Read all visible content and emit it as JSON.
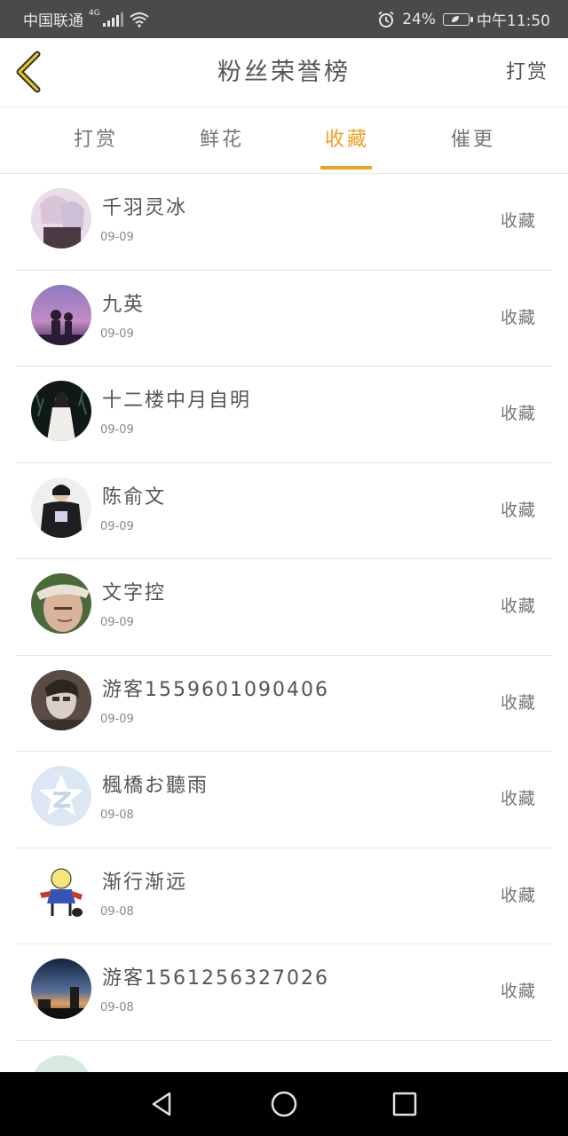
{
  "status_bar": {
    "carrier": "中国联通",
    "network": "4G",
    "battery": "24%",
    "time": "中午11:50"
  },
  "header": {
    "title": "粉丝荣誉榜",
    "action": "打赏"
  },
  "tabs": [
    {
      "label": "打赏",
      "active": false
    },
    {
      "label": "鲜花",
      "active": false
    },
    {
      "label": "收藏",
      "active": true
    },
    {
      "label": "催更",
      "active": false
    }
  ],
  "colors": {
    "accent": "#f0a020",
    "status_bar_bg": "#4a4a4a",
    "nav_bar_bg": "#000000"
  },
  "list": [
    {
      "name": "千羽灵冰",
      "date": "09-09",
      "action": "收藏",
      "avatar": "anime-girl"
    },
    {
      "name": "九英",
      "date": "09-09",
      "action": "收藏",
      "avatar": "purple-sky"
    },
    {
      "name": "十二楼中月自明",
      "date": "09-09",
      "action": "收藏",
      "avatar": "white-dress"
    },
    {
      "name": "陈俞文",
      "date": "09-09",
      "action": "收藏",
      "avatar": "dark-hoodie"
    },
    {
      "name": "文字控",
      "date": "09-09",
      "action": "收藏",
      "avatar": "hat-man"
    },
    {
      "name": "游客1559601090406",
      "date": "09-09",
      "action": "收藏",
      "avatar": "portrait"
    },
    {
      "name": "楓橋お聽雨",
      "date": "09-08",
      "action": "收藏",
      "avatar": "qq-default"
    },
    {
      "name": "渐行渐远",
      "date": "09-08",
      "action": "收藏",
      "avatar": "cartoon"
    },
    {
      "name": "游客1561256327026",
      "date": "09-08",
      "action": "收藏",
      "avatar": "city-night"
    },
    {
      "name": "",
      "date": "",
      "action": "",
      "avatar": "partial"
    }
  ],
  "nav_bar": {
    "icons": [
      "back-triangle-icon",
      "home-circle-icon",
      "recents-square-icon"
    ]
  }
}
